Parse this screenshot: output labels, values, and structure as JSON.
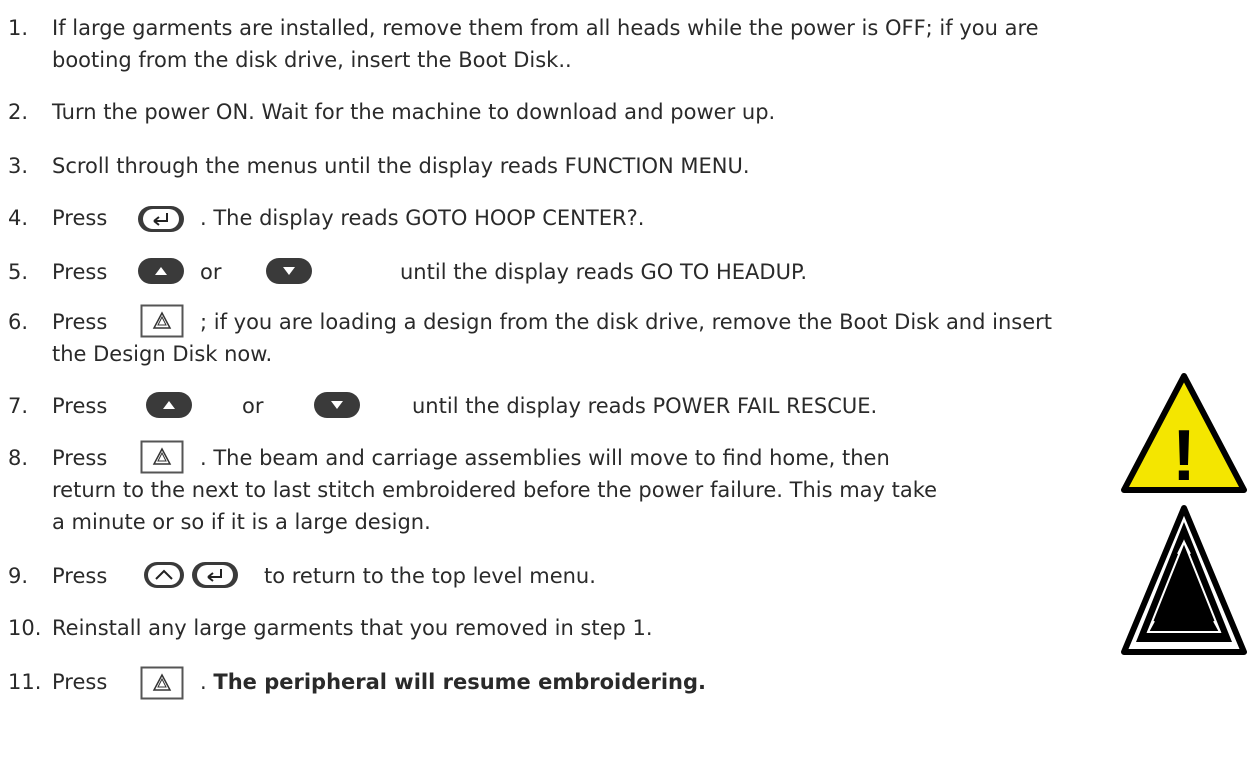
{
  "steps": [
    {
      "num": "1.",
      "lines": [
        "If large garments are installed, remove them from all heads while the power is OFF; if you are",
        "booting from the disk drive, insert the Boot Disk.."
      ]
    },
    {
      "num": "2.",
      "lines": [
        "Turn the power ON. Wait for the machine to download and power up."
      ]
    },
    {
      "num": "3.",
      "lines": [
        "Scroll through the menus until the display reads FUNCTION MENU."
      ]
    },
    {
      "num": "4.",
      "press": "Press",
      "after": ". The display reads GOTO HOOP CENTER?.",
      "icons": [
        "enter-key"
      ]
    },
    {
      "num": "5.",
      "press": "Press",
      "or": "or",
      "after": "until the display reads GO TO HEADUP.",
      "icons": [
        "up-arrow-key",
        "down-arrow-key"
      ]
    },
    {
      "num": "6.",
      "press": "Press",
      "after": "; if you are loading a design from the disk drive, remove the Boot Disk and insert",
      "cont": "the Design Disk now.",
      "icons": [
        "start-stop-key"
      ]
    },
    {
      "num": "7.",
      "press": "Press",
      "or": "or",
      "after": "until the display reads POWER FAIL RESCUE.",
      "icons": [
        "up-arrow-key",
        "down-arrow-key"
      ]
    },
    {
      "num": "8.",
      "press": "Press",
      "after": ". The beam and carriage assemblies will move to find home, then",
      "cont": [
        "return to the next to last stitch embroidered before the power failure. This may take",
        "a minute or so if it is a large design."
      ],
      "icons": [
        "start-stop-key"
      ]
    },
    {
      "num": "9.",
      "press": "Press",
      "after": "to return to the top level menu.",
      "icons": [
        "top-menu-key",
        "enter-key"
      ]
    },
    {
      "num": "10.",
      "lines": [
        "Reinstall any large garments that you removed in step 1."
      ]
    },
    {
      "num": "11.",
      "press": "Press",
      "after_plain": ".",
      "after_bold": "The peripheral will resume embroidering.",
      "icons": [
        "start-stop-key"
      ]
    }
  ],
  "warning_sign": {
    "symbol": "!",
    "yellow": "#f4e600",
    "black": "#000000"
  }
}
